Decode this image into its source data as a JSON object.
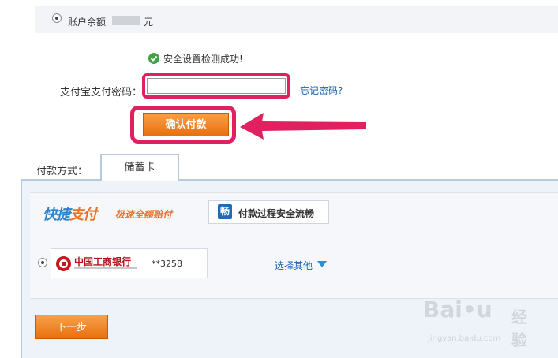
{
  "balance": {
    "label": "账户余额",
    "unit": "元",
    "selected": false
  },
  "security": {
    "message": "安全设置检测成功!",
    "icon": "check-circle-icon",
    "icon_color": "#43a047"
  },
  "password": {
    "label": "支付宝支付密码：",
    "value": "",
    "forgot_link": "忘记密码?"
  },
  "confirm": {
    "label": "确认付款"
  },
  "annotation": {
    "highlight_color": "#e0205f",
    "arrow": "pointer-arrow"
  },
  "payment": {
    "method_label": "付款方式：",
    "tabs": [
      {
        "label": "储蓄卡",
        "active": true
      }
    ],
    "quickpay": {
      "brand_prefix": "快捷",
      "brand_accent": "支付",
      "tagline": "极速全额赔付",
      "secure_icon_char": "畅",
      "secure_text": "付款过程安全流畅"
    },
    "card": {
      "bank_name": "中国工商银行",
      "card_number": "**3258",
      "selected": true
    },
    "select_other": "选择其他"
  },
  "next": {
    "label": "下一步"
  },
  "watermark": {
    "brand": "Bai",
    "brand_end": "u",
    "jingyan": "经验",
    "url": "jingyan.baidu.com"
  },
  "colors": {
    "accent_orange": "#e9700d",
    "link_blue": "#1a62b2",
    "tab_border": "#b8c9e0"
  }
}
